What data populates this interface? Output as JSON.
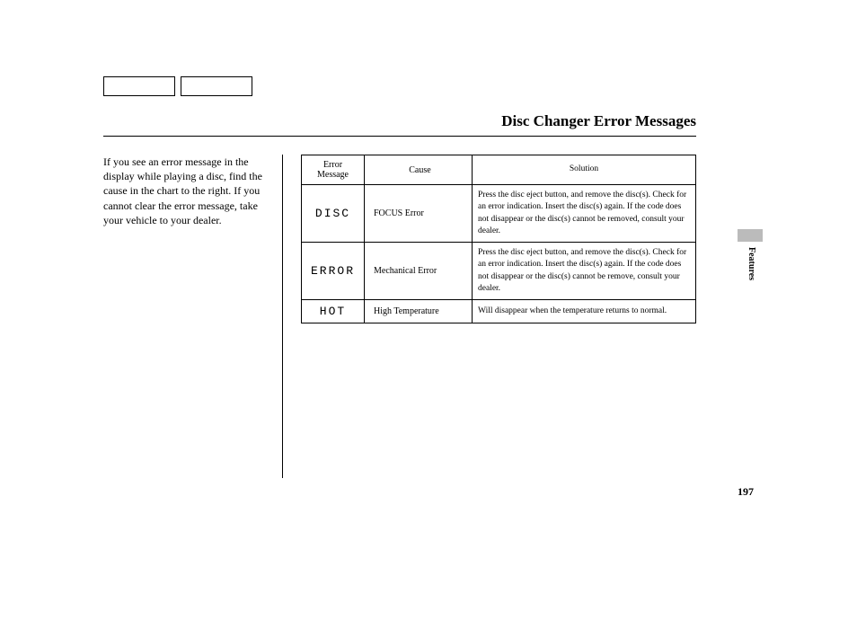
{
  "title": "Disc Changer Error Messages",
  "intro": "If you see an error message in the display while playing a disc, find the cause in the chart to the right. If you cannot clear the error message, take your vehicle to your dealer.",
  "table": {
    "headers": {
      "msg": "Error Message",
      "cause": "Cause",
      "solution": "Solution"
    },
    "rows": [
      {
        "msg": "DISC",
        "cause": "FOCUS Error",
        "solution": "Press the disc eject button, and remove the disc(s). Check for an error indication. Insert the disc(s) again. If the code does not disappear or the disc(s) cannot be removed, consult your dealer."
      },
      {
        "msg": "ERROR",
        "cause": "Mechanical Error",
        "solution": "Press the disc eject button, and remove the disc(s). Check for an error indication. Insert the disc(s) again. If the code does not disappear or the disc(s) cannot be remove, consult your dealer."
      },
      {
        "msg": "HOT",
        "cause": "High Temperature",
        "solution": "Will disappear when the temperature returns to normal."
      }
    ]
  },
  "sideLabel": "Features",
  "pageNumber": "197"
}
